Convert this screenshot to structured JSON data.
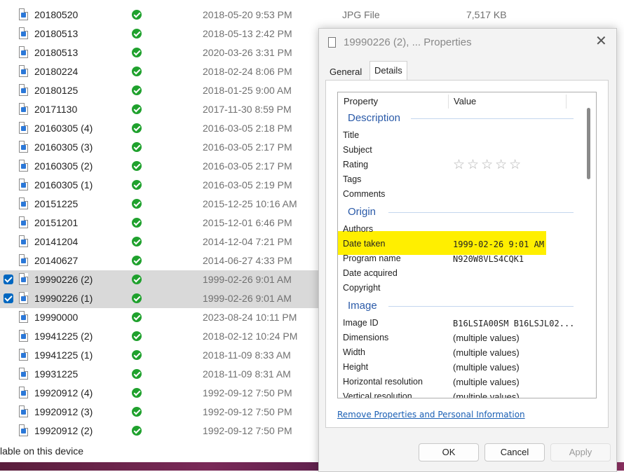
{
  "file_list": {
    "rows": [
      {
        "name": "20180520",
        "date": "2018-05-20 9:53 PM",
        "type": "JPG File",
        "size": "7,517 KB",
        "selected": false
      },
      {
        "name": "20180513",
        "date": "2018-05-13 2:42 PM",
        "type": "",
        "size": "",
        "selected": false
      },
      {
        "name": "20180513",
        "date": "2020-03-26 3:31 PM",
        "type": "",
        "size": "",
        "selected": false
      },
      {
        "name": "20180224",
        "date": "2018-02-24 8:06 PM",
        "type": "",
        "size": "",
        "selected": false
      },
      {
        "name": "20180125",
        "date": "2018-01-25 9:00 AM",
        "type": "",
        "size": "",
        "selected": false
      },
      {
        "name": "20171130",
        "date": "2017-11-30 8:59 PM",
        "type": "",
        "size": "",
        "selected": false
      },
      {
        "name": "20160305 (4)",
        "date": "2016-03-05 2:18 PM",
        "type": "",
        "size": "",
        "selected": false
      },
      {
        "name": "20160305 (3)",
        "date": "2016-03-05 2:17 PM",
        "type": "",
        "size": "",
        "selected": false
      },
      {
        "name": "20160305 (2)",
        "date": "2016-03-05 2:17 PM",
        "type": "",
        "size": "",
        "selected": false
      },
      {
        "name": "20160305 (1)",
        "date": "2016-03-05 2:19 PM",
        "type": "",
        "size": "",
        "selected": false
      },
      {
        "name": "20151225",
        "date": "2015-12-25 10:16 AM",
        "type": "",
        "size": "",
        "selected": false
      },
      {
        "name": "20151201",
        "date": "2015-12-01 6:46 PM",
        "type": "",
        "size": "",
        "selected": false
      },
      {
        "name": "20141204",
        "date": "2014-12-04 7:21 PM",
        "type": "",
        "size": "",
        "selected": false
      },
      {
        "name": "20140627",
        "date": "2014-06-27 4:33 PM",
        "type": "",
        "size": "",
        "selected": false
      },
      {
        "name": "19990226 (2)",
        "date": "1999-02-26 9:01 AM",
        "type": "",
        "size": "",
        "selected": true
      },
      {
        "name": "19990226 (1)",
        "date": "1999-02-26 9:01 AM",
        "type": "",
        "size": "",
        "selected": true
      },
      {
        "name": "19990000",
        "date": "2023-08-24 10:11 PM",
        "type": "",
        "size": "",
        "selected": false
      },
      {
        "name": "19941225 (2)",
        "date": "2018-02-12 10:24 PM",
        "type": "",
        "size": "",
        "selected": false
      },
      {
        "name": "19941225 (1)",
        "date": "2018-11-09 8:33 AM",
        "type": "",
        "size": "",
        "selected": false
      },
      {
        "name": "19931225",
        "date": "2018-11-09 8:31 AM",
        "type": "",
        "size": "",
        "selected": false
      },
      {
        "name": "19920912 (4)",
        "date": "1992-09-12 7:50 PM",
        "type": "",
        "size": "",
        "selected": false
      },
      {
        "name": "19920912 (3)",
        "date": "1992-09-12 7:50 PM",
        "type": "",
        "size": "",
        "selected": false
      },
      {
        "name": "19920912 (2)",
        "date": "1992-09-12 7:50 PM",
        "type": "",
        "size": "",
        "selected": false
      }
    ],
    "status_text": "lable on this device"
  },
  "dialog": {
    "title": "19990226 (2), ... Properties",
    "close_glyph": "✕",
    "tabs": {
      "general": "General",
      "details": "Details"
    },
    "columns": {
      "property": "Property",
      "value": "Value"
    },
    "groups": {
      "description": "Description",
      "origin": "Origin",
      "image": "Image"
    },
    "props": {
      "title": "Title",
      "subject": "Subject",
      "rating": "Rating",
      "rating_stars": "☆☆☆☆☆",
      "rating_value": 0,
      "tags": "Tags",
      "comments": "Comments",
      "authors": "Authors",
      "date_taken": "Date taken",
      "date_taken_value": "1999-02-26 9:01 AM",
      "program_name": "Program name",
      "program_name_value": "N920W8VLS4CQK1",
      "date_acquired": "Date acquired",
      "copyright": "Copyright",
      "image_id": "Image ID",
      "image_id_value": "B16LSIA00SM B16LSJL02...",
      "dimensions": "Dimensions",
      "dimensions_value": "(multiple values)",
      "width": "Width",
      "width_value": "(multiple values)",
      "height": "Height",
      "height_value": "(multiple values)",
      "horizontal_resolution": "Horizontal resolution",
      "horizontal_resolution_value": "(multiple values)",
      "vertical_resolution": "Vertical resolution",
      "vertical_resolution_value": "(multiple values)"
    },
    "remove_link": "Remove Properties and Personal Information",
    "buttons": {
      "ok": "OK",
      "cancel": "Cancel",
      "apply": "Apply"
    },
    "highlight_color": "#ffef00"
  },
  "colors": {
    "selection": "#d9d9d9",
    "checkbox": "#0067c0",
    "sync_ok": "#1fa12d",
    "group_heading": "#2a5aa8",
    "link": "#1a5fb4"
  }
}
